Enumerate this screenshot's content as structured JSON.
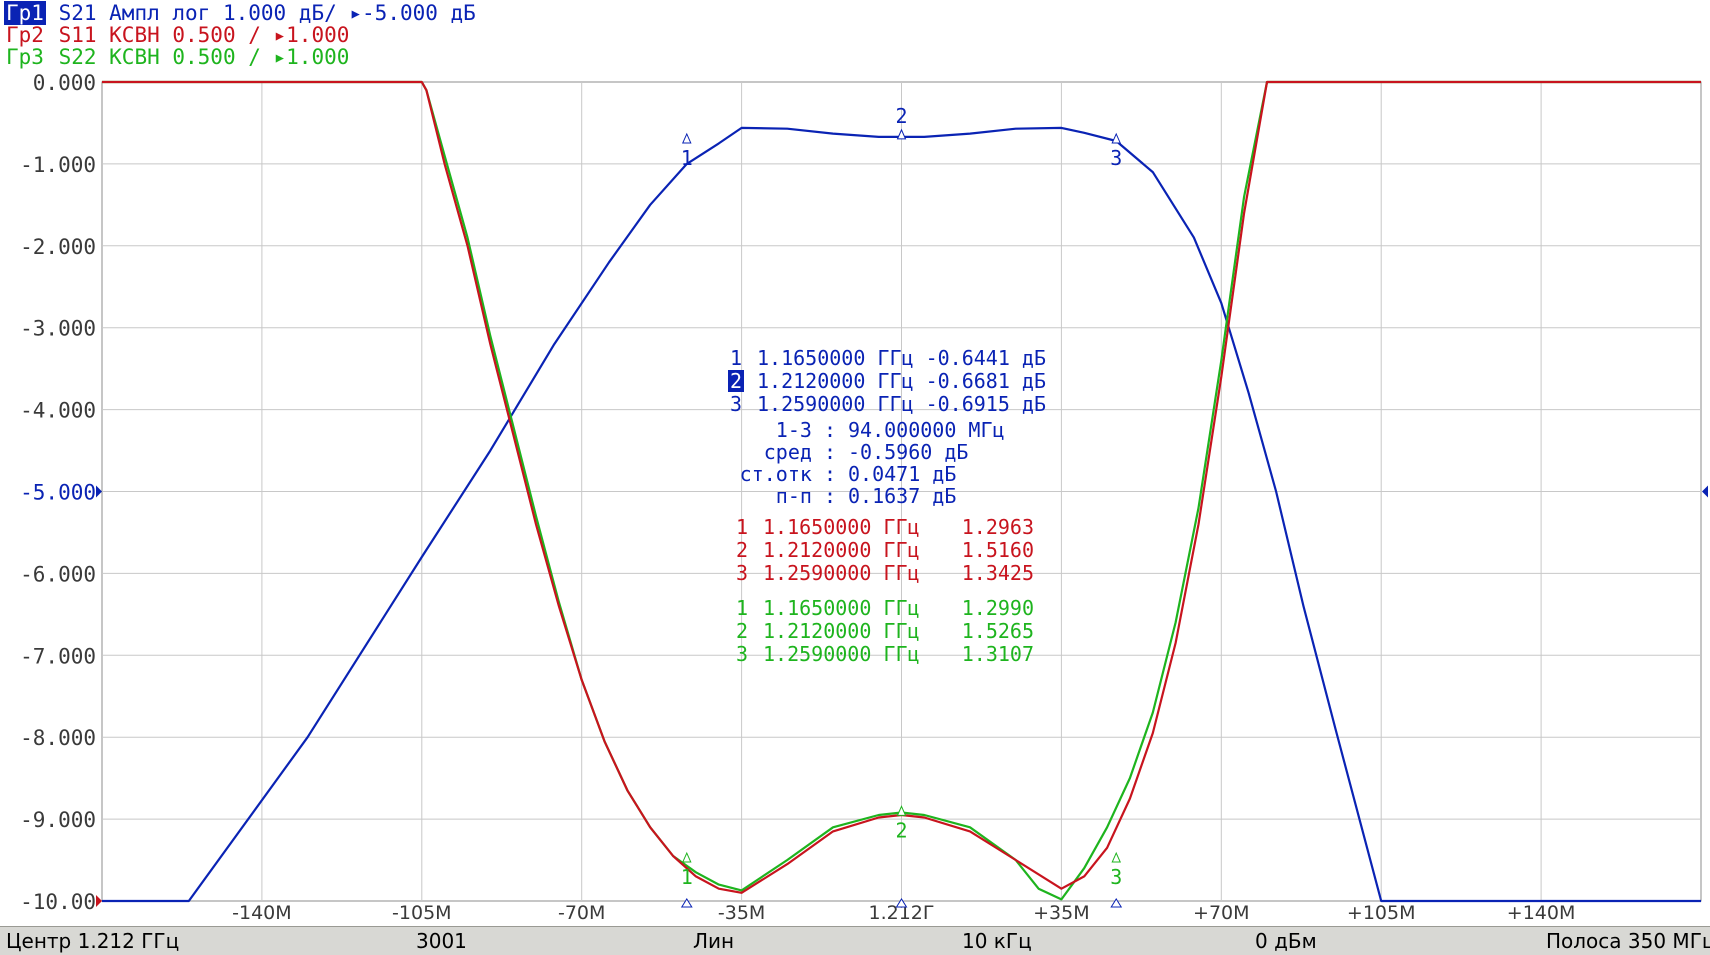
{
  "headers": [
    {
      "tag": "Гр1",
      "text": "S21 Ампл лог 1.000 дБ/ ▸-5.000 дБ",
      "active": true
    },
    {
      "tag": "Гр2",
      "text": "S11 КСВН 0.500 / ▸1.000",
      "active": false
    },
    {
      "tag": "Гр3",
      "text": "S22 КСВН 0.500 / ▸1.000",
      "active": false
    }
  ],
  "colors": {
    "s21": "#0a23b4",
    "s11": "#c8141e",
    "s22": "#1eb41e",
    "grid": "#c8c8c8",
    "axis_text": "#3a3a3a"
  },
  "chart_data": {
    "type": "line",
    "x_unit": "MHz offset from center",
    "xlim": [
      -175,
      175
    ],
    "ylim": [
      -10,
      0
    ],
    "grid": true,
    "y_tick_labels": [
      "0.000",
      "-1.000",
      "-2.000",
      "-3.000",
      "-4.000",
      "-5.000",
      "-6.000",
      "-7.000",
      "-8.000",
      "-9.000",
      "-10.00"
    ],
    "x_ticks": [
      {
        "x": -140,
        "label": "-140M"
      },
      {
        "x": -105,
        "label": "-105M"
      },
      {
        "x": -70,
        "label": "-70M"
      },
      {
        "x": -35,
        "label": "-35M"
      },
      {
        "x": 0,
        "label": "1.212Г"
      },
      {
        "x": 35,
        "label": "+35M"
      },
      {
        "x": 70,
        "label": "+70M"
      },
      {
        "x": 105,
        "label": "+105M"
      },
      {
        "x": 140,
        "label": "+140M"
      }
    ],
    "reference": {
      "s21_level": -5.0,
      "vswr_bottom": 1.0
    },
    "series": [
      {
        "key": "s21",
        "x": [
          -175,
          -156,
          -130,
          -105,
          -90,
          -76,
          -64,
          -55,
          -47,
          -40,
          -35,
          -25,
          -15,
          -5,
          0,
          5,
          15,
          25,
          35,
          40,
          47,
          55,
          64,
          70,
          76,
          82,
          88,
          95,
          105,
          112,
          175
        ],
        "y": [
          -10.0,
          -10.0,
          -8.0,
          -5.8,
          -4.5,
          -3.2,
          -2.2,
          -1.5,
          -1.0,
          -0.75,
          -0.56,
          -0.57,
          -0.63,
          -0.67,
          -0.67,
          -0.67,
          -0.63,
          -0.57,
          -0.56,
          -0.62,
          -0.72,
          -1.1,
          -1.9,
          -2.7,
          -3.8,
          -5.0,
          -6.4,
          -7.9,
          -10.0,
          -10.0,
          -10.0
        ]
      },
      {
        "key": "s11",
        "x": [
          -175,
          -105,
          -104,
          -100,
          -95,
          -90,
          -85,
          -80,
          -75,
          -70,
          -65,
          -60,
          -55,
          -50,
          -45,
          -40,
          -35,
          -25,
          -15,
          -5,
          0,
          5,
          15,
          25,
          35,
          40,
          45,
          50,
          55,
          60,
          65,
          70,
          75,
          80,
          105,
          175
        ],
        "y": [
          0.0,
          0.0,
          -0.1,
          -1.0,
          -2.0,
          -3.2,
          -4.3,
          -5.4,
          -6.4,
          -7.3,
          -8.05,
          -8.65,
          -9.1,
          -9.45,
          -9.7,
          -9.85,
          -9.9,
          -9.55,
          -9.15,
          -8.98,
          -8.95,
          -8.98,
          -9.15,
          -9.5,
          -9.85,
          -9.7,
          -9.35,
          -8.75,
          -7.95,
          -6.85,
          -5.4,
          -3.6,
          -1.6,
          0.0,
          0.0,
          0.0
        ]
      },
      {
        "key": "s22",
        "x": [
          -175,
          -105,
          -104,
          -100,
          -95,
          -90,
          -85,
          -80,
          -75,
          -70,
          -65,
          -60,
          -55,
          -50,
          -45,
          -40,
          -35,
          -25,
          -15,
          -5,
          0,
          5,
          15,
          25,
          30,
          35,
          40,
          45,
          50,
          55,
          60,
          65,
          70,
          75,
          80,
          105,
          175
        ],
        "y": [
          0.0,
          0.0,
          -0.1,
          -0.9,
          -1.9,
          -3.1,
          -4.2,
          -5.3,
          -6.35,
          -7.3,
          -8.05,
          -8.65,
          -9.1,
          -9.45,
          -9.65,
          -9.8,
          -9.87,
          -9.5,
          -9.1,
          -8.95,
          -8.92,
          -8.95,
          -9.1,
          -9.5,
          -9.85,
          -9.98,
          -9.6,
          -9.1,
          -8.5,
          -7.7,
          -6.6,
          -5.2,
          -3.4,
          -1.4,
          0.0,
          0.0,
          0.0
        ]
      }
    ],
    "markers": [
      {
        "series": "s21",
        "label": "1",
        "x": -47,
        "y": -0.72,
        "text_below": true
      },
      {
        "series": "s21",
        "label": "2",
        "x": 0,
        "y": -0.67,
        "text_below": false
      },
      {
        "series": "s21",
        "label": "3",
        "x": 47,
        "y": -0.72,
        "text_below": true
      },
      {
        "series": "s22",
        "label": "1",
        "x": -47,
        "y": -9.5,
        "text_below": true
      },
      {
        "series": "s22",
        "label": "2",
        "x": 0,
        "y": -8.93,
        "text_below": true
      },
      {
        "series": "s22",
        "label": "3",
        "x": 47,
        "y": -9.5,
        "text_below": true
      }
    ],
    "marker_table": {
      "s21": [
        {
          "n": "1",
          "freq": "1.1650000 ГГц",
          "value": "-0.6441 дБ",
          "active": false
        },
        {
          "n": "2",
          "freq": "1.2120000 ГГц",
          "value": "-0.6681 дБ",
          "active": true
        },
        {
          "n": "3",
          "freq": "1.2590000 ГГц",
          "value": "-0.6915 дБ",
          "active": false
        }
      ],
      "stats": [
        {
          "name": "1-3 :",
          "value": "94.000000 МГц"
        },
        {
          "name": "сред :",
          "value": "-0.5960 дБ"
        },
        {
          "name": "ст.отк :",
          "value": "0.0471 дБ"
        },
        {
          "name": "п-п :",
          "value": "0.1637 дБ"
        }
      ],
      "s11": [
        {
          "n": "1",
          "freq": "1.1650000 ГГц",
          "value": "1.2963"
        },
        {
          "n": "2",
          "freq": "1.2120000 ГГц",
          "value": "1.5160"
        },
        {
          "n": "3",
          "freq": "1.2590000 ГГц",
          "value": "1.3425"
        }
      ],
      "s22": [
        {
          "n": "1",
          "freq": "1.1650000 ГГц",
          "value": "1.2990"
        },
        {
          "n": "2",
          "freq": "1.2120000 ГГц",
          "value": "1.5265"
        },
        {
          "n": "3",
          "freq": "1.2590000 ГГц",
          "value": "1.3107"
        }
      ]
    }
  },
  "status": {
    "center": "Центр 1.212 ГГц",
    "points": "3001",
    "sweep_type": "Лин",
    "ifbw": "10 кГц",
    "power": "0 дБм",
    "span": "Полоса 350 МГц"
  }
}
